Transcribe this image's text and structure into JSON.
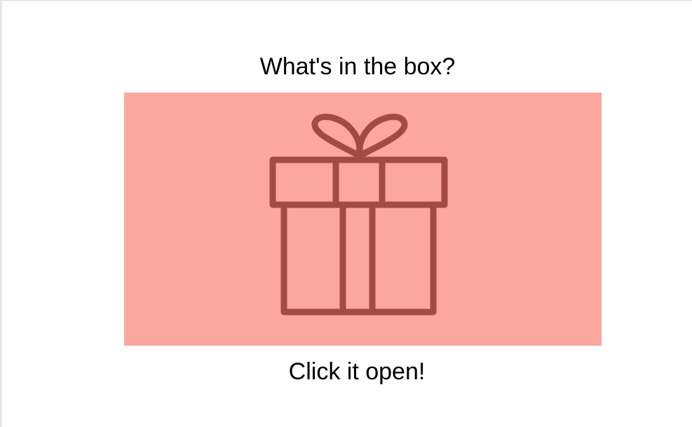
{
  "page": {
    "heading": "What's in the box?",
    "caption": "Click it open!"
  },
  "gift": {
    "icon": "gift-icon",
    "panel_color": "#fba79f",
    "icon_color": "#a24a43"
  }
}
